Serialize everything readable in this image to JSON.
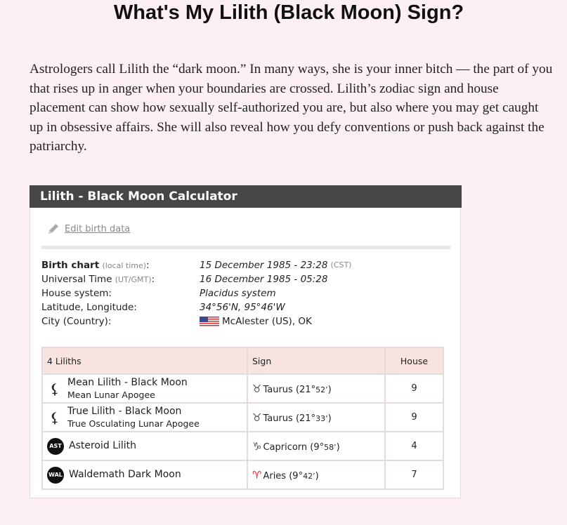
{
  "page": {
    "title": "What's My Lilith (Black Moon) Sign?",
    "intro": "Astrologers call Lilith the “dark moon.” In many ways, she is your inner bitch — the part of you that rises up in anger when your boundaries are crossed. Lilith’s zodiac sign and house placement can show how sexually self-authorized you are, but also where you may get caught up in obsessive affairs. She will also reveal how you defy conventions or push back against the patriarchy."
  },
  "widget": {
    "title": "Lilith - Black Moon Calculator",
    "edit_label": "Edit birth data",
    "info": {
      "birth_chart_label": "Birth chart",
      "birth_chart_note": "(local time)",
      "birth_chart_value": "15 December 1985 - 23:28",
      "birth_chart_tz": "(CST)",
      "ut_label": "Universal Time",
      "ut_note": "(UT/GMT)",
      "ut_value": "16 December 1985 - 05:28",
      "house_label": "House system:",
      "house_value": "Placidus system",
      "latlon_label": "Latitude, Longitude:",
      "latlon_value": "34°56'N, 95°46'W",
      "city_label": "City (Country):",
      "city_value": "McAlester (US), OK"
    },
    "table": {
      "headers": [
        "4 Liliths",
        "Sign",
        "House"
      ],
      "rows": [
        {
          "glyph": "⚸",
          "name": "Mean Lilith - Black Moon",
          "sub": "Mean Lunar Apogee",
          "sign_glyph": "♉",
          "sign": "Taurus",
          "deg": "21",
          "min": "52’",
          "house": "9"
        },
        {
          "glyph": "⚸",
          "name": "True Lilith - Black Moon",
          "sub": "True Osculating Lunar Apogee",
          "sign_glyph": "♉",
          "sign": "Taurus",
          "deg": "21",
          "min": "33’",
          "house": "9"
        },
        {
          "badge": "AST",
          "name": "Asteroid Lilith",
          "sub": "",
          "sign_glyph": "♑",
          "sign": "Capricorn",
          "deg": "9",
          "min": "58’",
          "house": "4"
        },
        {
          "badge": "WAL",
          "name": "Waldemath Dark Moon",
          "sub": "",
          "sign_glyph": "♈",
          "sign": "Aries",
          "deg": "9",
          "min": "42’",
          "house": "7"
        }
      ]
    }
  },
  "icons": {
    "edit": "pencil-icon",
    "flag": "us-flag-icon"
  },
  "colors": {
    "header_bg": "#464646",
    "table_header_bg": "#f8e3df",
    "aries_red": "#d22222"
  }
}
